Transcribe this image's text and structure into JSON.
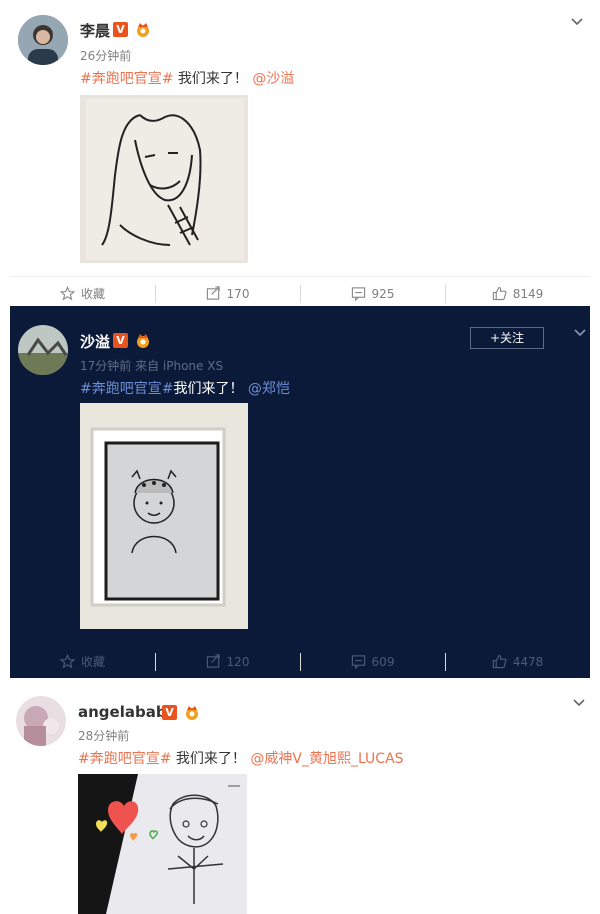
{
  "posts": [
    {
      "username": "李晨",
      "time": "26分钟前",
      "tag": "#奔跑吧官宣#",
      "body": " 我们来了！",
      "mention": "@沙溢",
      "actions": {
        "fav": "收藏",
        "repost": "170",
        "comment": "925",
        "like": "8149"
      }
    },
    {
      "username": "沙溢",
      "time": "17分钟前 来自 iPhone XS",
      "tag": "#奔跑吧官宣#",
      "body": "我们来了！",
      "mention": "@郑恺",
      "follow": "+关注",
      "actions": {
        "fav": "收藏",
        "repost": "120",
        "comment": "609",
        "like": "4478"
      }
    },
    {
      "username": "angelababy",
      "time": "28分钟前",
      "tag": "#奔跑吧官宣#",
      "body": " 我们来了！",
      "mention": "@威神V_黄旭熙_LUCAS"
    }
  ],
  "colors": {
    "accent": "#eb7350",
    "link": "#eb7350",
    "dark_bg": "#0b1a38",
    "badge": "#e8531e"
  }
}
